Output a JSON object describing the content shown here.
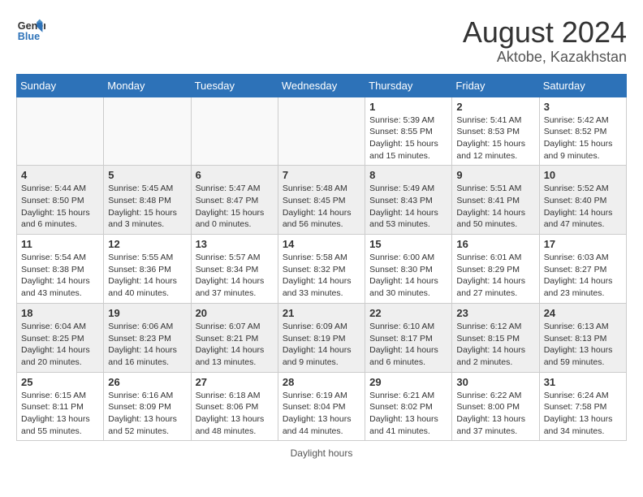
{
  "header": {
    "logo_line1": "General",
    "logo_line2": "Blue",
    "month_year": "August 2024",
    "location": "Aktobe, Kazakhstan"
  },
  "weekdays": [
    "Sunday",
    "Monday",
    "Tuesday",
    "Wednesday",
    "Thursday",
    "Friday",
    "Saturday"
  ],
  "weeks": [
    [
      {
        "day": "",
        "info": ""
      },
      {
        "day": "",
        "info": ""
      },
      {
        "day": "",
        "info": ""
      },
      {
        "day": "",
        "info": ""
      },
      {
        "day": "1",
        "info": "Sunrise: 5:39 AM\nSunset: 8:55 PM\nDaylight: 15 hours\nand 15 minutes."
      },
      {
        "day": "2",
        "info": "Sunrise: 5:41 AM\nSunset: 8:53 PM\nDaylight: 15 hours\nand 12 minutes."
      },
      {
        "day": "3",
        "info": "Sunrise: 5:42 AM\nSunset: 8:52 PM\nDaylight: 15 hours\nand 9 minutes."
      }
    ],
    [
      {
        "day": "4",
        "info": "Sunrise: 5:44 AM\nSunset: 8:50 PM\nDaylight: 15 hours\nand 6 minutes."
      },
      {
        "day": "5",
        "info": "Sunrise: 5:45 AM\nSunset: 8:48 PM\nDaylight: 15 hours\nand 3 minutes."
      },
      {
        "day": "6",
        "info": "Sunrise: 5:47 AM\nSunset: 8:47 PM\nDaylight: 15 hours\nand 0 minutes."
      },
      {
        "day": "7",
        "info": "Sunrise: 5:48 AM\nSunset: 8:45 PM\nDaylight: 14 hours\nand 56 minutes."
      },
      {
        "day": "8",
        "info": "Sunrise: 5:49 AM\nSunset: 8:43 PM\nDaylight: 14 hours\nand 53 minutes."
      },
      {
        "day": "9",
        "info": "Sunrise: 5:51 AM\nSunset: 8:41 PM\nDaylight: 14 hours\nand 50 minutes."
      },
      {
        "day": "10",
        "info": "Sunrise: 5:52 AM\nSunset: 8:40 PM\nDaylight: 14 hours\nand 47 minutes."
      }
    ],
    [
      {
        "day": "11",
        "info": "Sunrise: 5:54 AM\nSunset: 8:38 PM\nDaylight: 14 hours\nand 43 minutes."
      },
      {
        "day": "12",
        "info": "Sunrise: 5:55 AM\nSunset: 8:36 PM\nDaylight: 14 hours\nand 40 minutes."
      },
      {
        "day": "13",
        "info": "Sunrise: 5:57 AM\nSunset: 8:34 PM\nDaylight: 14 hours\nand 37 minutes."
      },
      {
        "day": "14",
        "info": "Sunrise: 5:58 AM\nSunset: 8:32 PM\nDaylight: 14 hours\nand 33 minutes."
      },
      {
        "day": "15",
        "info": "Sunrise: 6:00 AM\nSunset: 8:30 PM\nDaylight: 14 hours\nand 30 minutes."
      },
      {
        "day": "16",
        "info": "Sunrise: 6:01 AM\nSunset: 8:29 PM\nDaylight: 14 hours\nand 27 minutes."
      },
      {
        "day": "17",
        "info": "Sunrise: 6:03 AM\nSunset: 8:27 PM\nDaylight: 14 hours\nand 23 minutes."
      }
    ],
    [
      {
        "day": "18",
        "info": "Sunrise: 6:04 AM\nSunset: 8:25 PM\nDaylight: 14 hours\nand 20 minutes."
      },
      {
        "day": "19",
        "info": "Sunrise: 6:06 AM\nSunset: 8:23 PM\nDaylight: 14 hours\nand 16 minutes."
      },
      {
        "day": "20",
        "info": "Sunrise: 6:07 AM\nSunset: 8:21 PM\nDaylight: 14 hours\nand 13 minutes."
      },
      {
        "day": "21",
        "info": "Sunrise: 6:09 AM\nSunset: 8:19 PM\nDaylight: 14 hours\nand 9 minutes."
      },
      {
        "day": "22",
        "info": "Sunrise: 6:10 AM\nSunset: 8:17 PM\nDaylight: 14 hours\nand 6 minutes."
      },
      {
        "day": "23",
        "info": "Sunrise: 6:12 AM\nSunset: 8:15 PM\nDaylight: 14 hours\nand 2 minutes."
      },
      {
        "day": "24",
        "info": "Sunrise: 6:13 AM\nSunset: 8:13 PM\nDaylight: 13 hours\nand 59 minutes."
      }
    ],
    [
      {
        "day": "25",
        "info": "Sunrise: 6:15 AM\nSunset: 8:11 PM\nDaylight: 13 hours\nand 55 minutes."
      },
      {
        "day": "26",
        "info": "Sunrise: 6:16 AM\nSunset: 8:09 PM\nDaylight: 13 hours\nand 52 minutes."
      },
      {
        "day": "27",
        "info": "Sunrise: 6:18 AM\nSunset: 8:06 PM\nDaylight: 13 hours\nand 48 minutes."
      },
      {
        "day": "28",
        "info": "Sunrise: 6:19 AM\nSunset: 8:04 PM\nDaylight: 13 hours\nand 44 minutes."
      },
      {
        "day": "29",
        "info": "Sunrise: 6:21 AM\nSunset: 8:02 PM\nDaylight: 13 hours\nand 41 minutes."
      },
      {
        "day": "30",
        "info": "Sunrise: 6:22 AM\nSunset: 8:00 PM\nDaylight: 13 hours\nand 37 minutes."
      },
      {
        "day": "31",
        "info": "Sunrise: 6:24 AM\nSunset: 7:58 PM\nDaylight: 13 hours\nand 34 minutes."
      }
    ]
  ],
  "footer": "Daylight hours"
}
